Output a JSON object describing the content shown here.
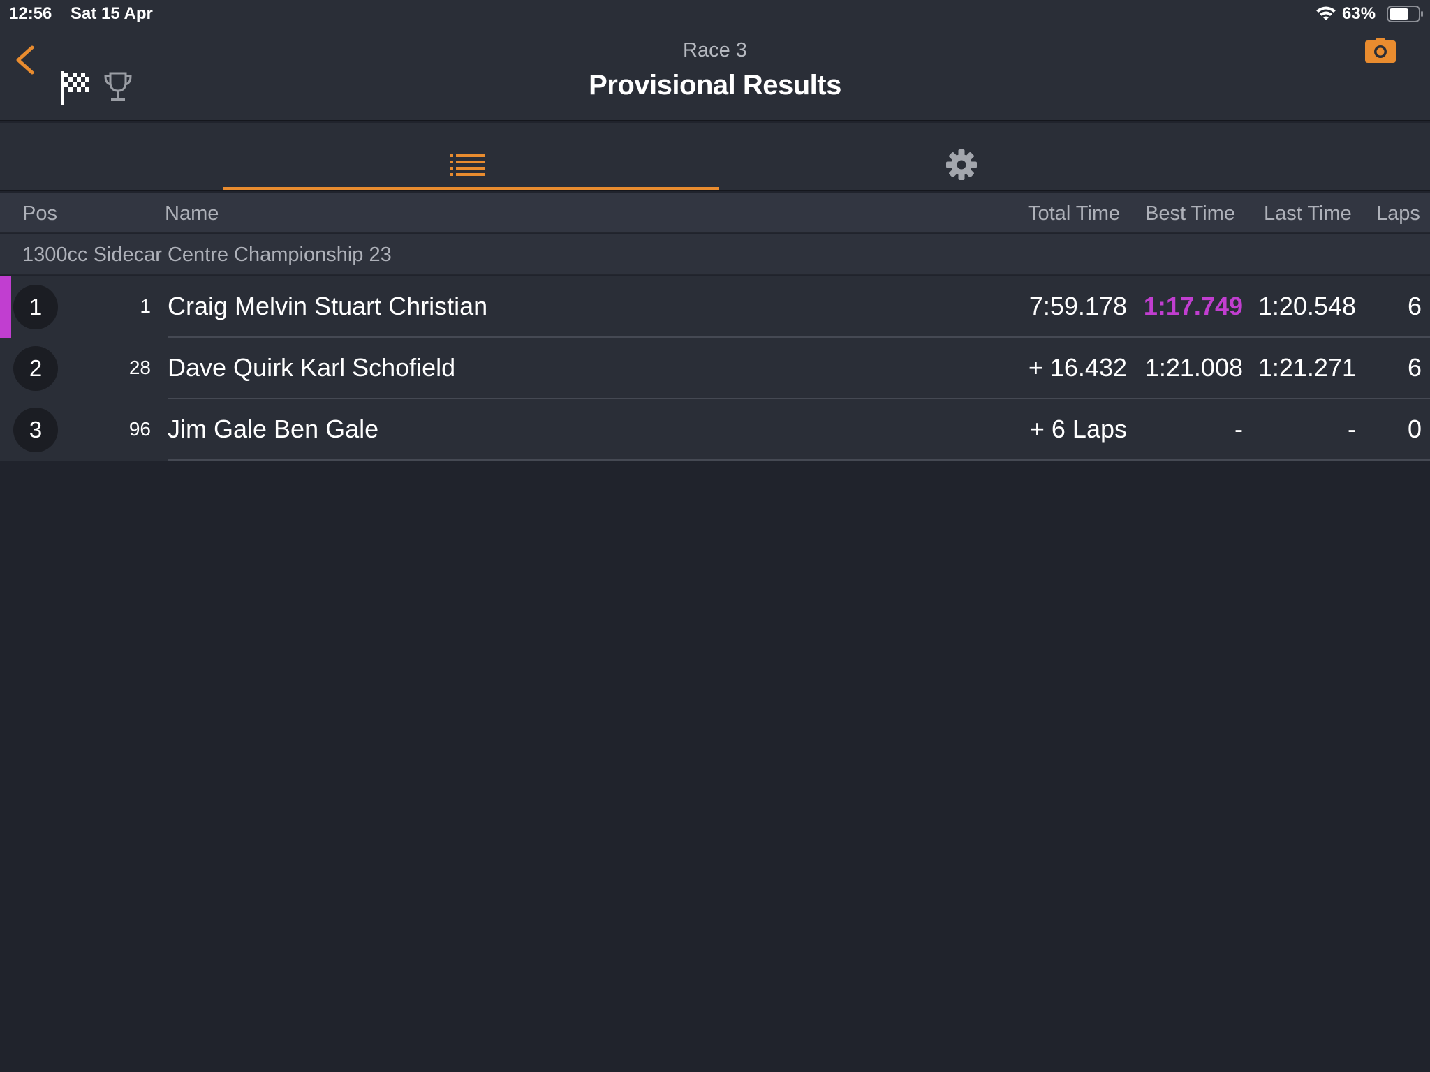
{
  "status_bar": {
    "time": "12:56",
    "date": "Sat 15 Apr",
    "battery": "63%"
  },
  "header": {
    "subtitle": "Race 3",
    "title": "Provisional Results"
  },
  "columns": {
    "pos": "Pos",
    "name": "Name",
    "total_time": "Total Time",
    "best_time": "Best Time",
    "last_time": "Last Time",
    "laps": "Laps"
  },
  "class_name": "1300cc Sidecar Centre Championship 23",
  "colors": {
    "accent": "#e98c2f",
    "fastest": "#c13ed0",
    "background": "#20232c",
    "surface": "#2a2e37"
  },
  "results": [
    {
      "pos": "1",
      "number": "1",
      "name": "Craig Melvin Stuart Christian",
      "total_time": "7:59.178",
      "best_time": "1:17.749",
      "last_time": "1:20.548",
      "laps": "6"
    },
    {
      "pos": "2",
      "number": "28",
      "name": "Dave Quirk Karl Schofield",
      "total_time": "+ 16.432",
      "best_time": "1:21.008",
      "last_time": "1:21.271",
      "laps": "6"
    },
    {
      "pos": "3",
      "number": "96",
      "name": "Jim Gale Ben Gale",
      "total_time": "+ 6 Laps",
      "best_time": "-",
      "last_time": "-",
      "laps": "0"
    }
  ]
}
